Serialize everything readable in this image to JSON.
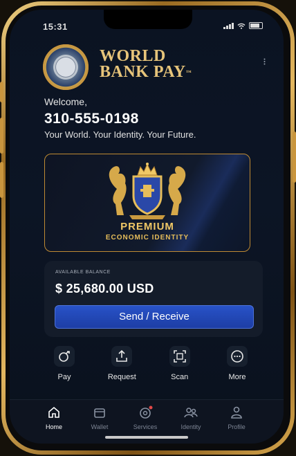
{
  "status": {
    "time": "15:31"
  },
  "brand": {
    "line1": "WORLD",
    "line2": "BANK PAY",
    "mark": "™"
  },
  "welcome": {
    "greeting": "Welcome,",
    "phone": "310-555-0198",
    "tagline": "Your World. Your Identity. Your Future."
  },
  "card": {
    "title": "PREMIUM",
    "subtitle": "ECONOMIC IDENTITY"
  },
  "balance": {
    "label": "AVAILABLE BALANCE",
    "amount": "$ 25,680.00 USD",
    "button": "Send / Receive"
  },
  "actions": [
    {
      "label": "Pay",
      "icon": "pay-icon"
    },
    {
      "label": "Request",
      "icon": "request-icon"
    },
    {
      "label": "Scan",
      "icon": "scan-icon"
    },
    {
      "label": "More",
      "icon": "more-icon"
    }
  ],
  "tabs": [
    {
      "label": "Home",
      "icon": "home-icon",
      "active": true
    },
    {
      "label": "Wallet",
      "icon": "wallet-icon"
    },
    {
      "label": "Services",
      "icon": "services-icon"
    },
    {
      "label": "Identity",
      "icon": "identity-icon"
    },
    {
      "label": "Profile",
      "icon": "profile-icon"
    }
  ],
  "colors": {
    "gold": "#e6c47a",
    "accent": "#2852c7",
    "background": "#0b1322",
    "frame": "#c9953d"
  }
}
